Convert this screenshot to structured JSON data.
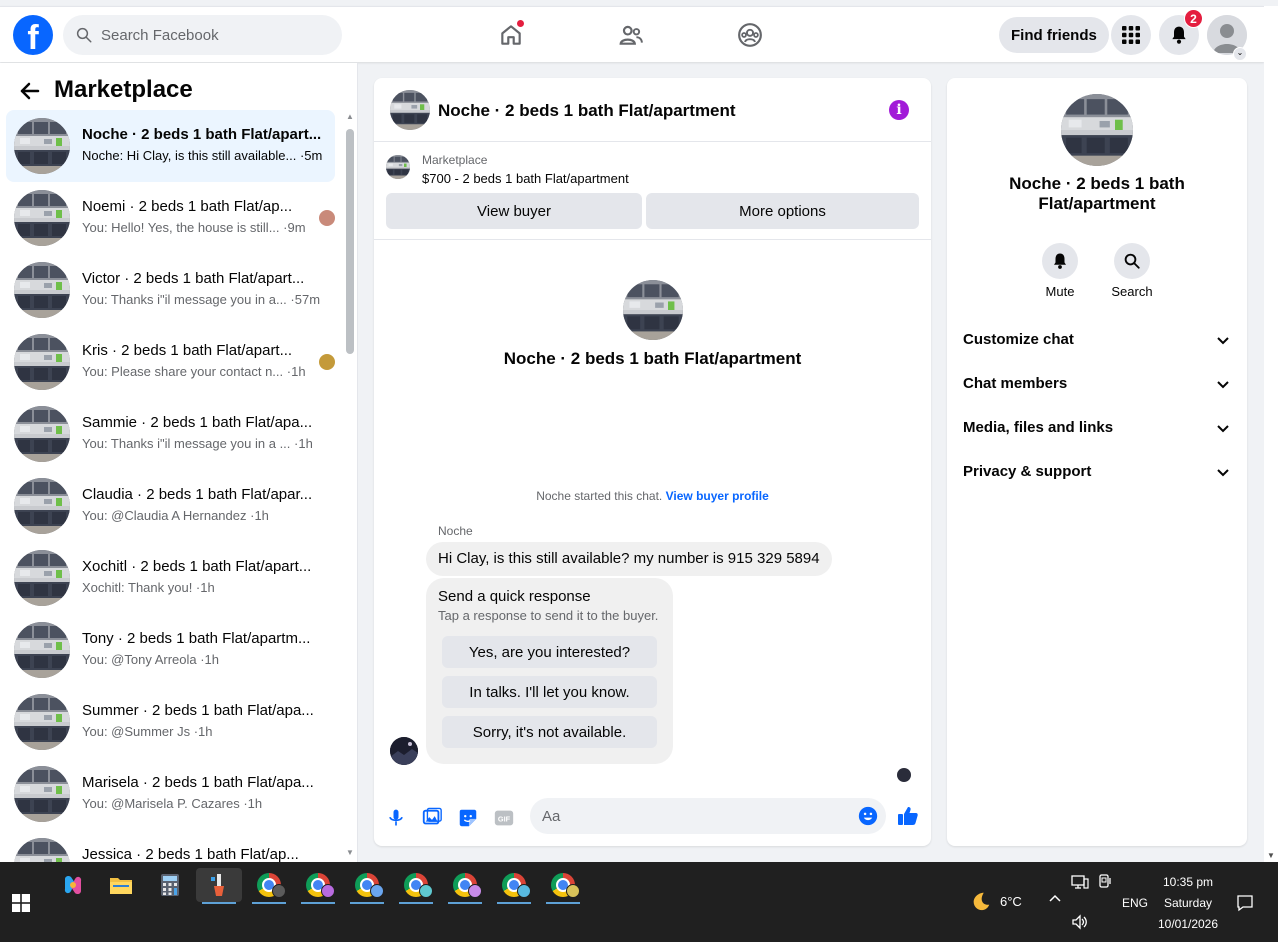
{
  "topbar": {
    "logo": "f",
    "search_placeholder": "Search Facebook",
    "find_friends_label": "Find friends",
    "notification_count": "2"
  },
  "sidebar": {
    "title": "Marketplace",
    "conversations": [
      {
        "title": "Noche · 2 beds 1 bath Flat/apart...",
        "preview": "Noche: Hi Clay, is this still available... ·5m"
      },
      {
        "title": "Noemi · 2 beds 1 bath Flat/ap...",
        "preview": "You: Hello! Yes, the house is still... ·9m"
      },
      {
        "title": "Victor · 2 beds 1 bath Flat/apart...",
        "preview": "You: Thanks i\"il message you in a... ·57m"
      },
      {
        "title": "Kris · 2 beds 1 bath Flat/apart...",
        "preview": "You: Please share your contact n... ·1h"
      },
      {
        "title": "Sammie · 2 beds 1 bath Flat/apa...",
        "preview": "You: Thanks i\"il message you in a ...  ·1h"
      },
      {
        "title": "Claudia · 2 beds 1 bath Flat/apar...",
        "preview": "You: @Claudia A Hernandez ·1h"
      },
      {
        "title": "Xochitl · 2 beds 1 bath Flat/apart...",
        "preview": "Xochitl: Thank you! ·1h"
      },
      {
        "title": "Tony · 2 beds 1 bath Flat/apartm...",
        "preview": "You: @Tony Arreola ·1h"
      },
      {
        "title": "Summer · 2 beds 1 bath Flat/apa...",
        "preview": "You: @Summer Js ·1h"
      },
      {
        "title": "Marisela · 2 beds 1 bath Flat/apa...",
        "preview": "You: @Marisela P. Cazares ·1h"
      },
      {
        "title": "Jessica · 2 beds 1 bath Flat/ap...",
        "preview": ""
      }
    ]
  },
  "chat": {
    "header_title": "Noche · 2 beds 1 bath Flat/apartment",
    "listing_source": "Marketplace",
    "listing_price_title": "$700 - 2 beds 1 bath Flat/apartment",
    "view_buyer_label": "View buyer",
    "more_options_label": "More options",
    "intro_title": "Noche · 2 beds 1 bath Flat/apartment",
    "started_text": "Noche started this chat.",
    "view_profile_link": "View buyer profile",
    "sender_name": "Noche",
    "message_text": "Hi Clay, is this still available? my number is 915 329 5894",
    "quick_title": "Send a quick response",
    "quick_subtitle": "Tap a response to send it to the buyer.",
    "quick_options": [
      "Yes, are you interested?",
      "In talks. I'll let you know.",
      "Sorry, it's not available."
    ],
    "composer_placeholder": "Aa",
    "gif_label": "GIF"
  },
  "rpanel": {
    "title": "Noche · 2 beds 1 bath Flat/apartment",
    "mute_label": "Mute",
    "search_label": "Search",
    "sections": [
      "Customize chat",
      "Chat members",
      "Media, files and links",
      "Privacy & support"
    ]
  },
  "taskbar": {
    "temperature": "6°C",
    "language": "ENG",
    "time": "10:35 pm",
    "day": "Saturday",
    "date": "10/01/2026"
  },
  "colors": {
    "brand_blue": "#0866ff",
    "active_row": "#ebf5ff",
    "info_purple": "#a21bd8",
    "badge_red": "#e41e3f"
  }
}
